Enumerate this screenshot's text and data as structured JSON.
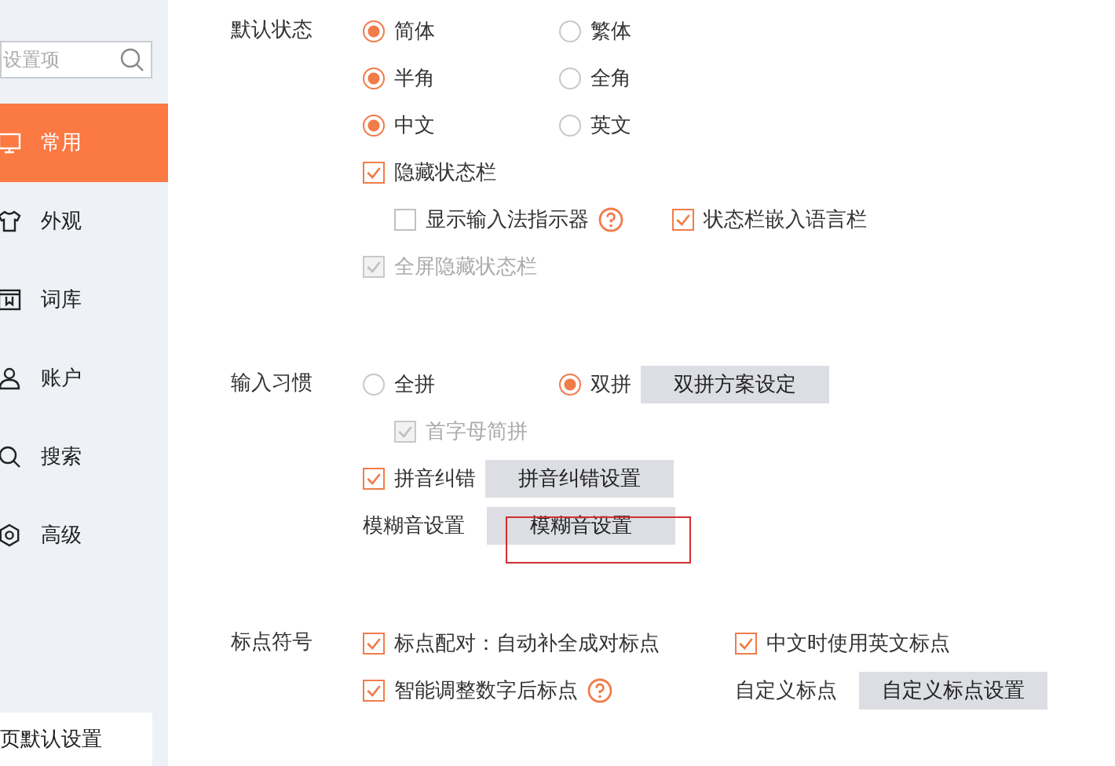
{
  "sidebar": {
    "search": {
      "placeholder": "设置项"
    },
    "items": [
      {
        "label": "常用",
        "selected": true
      },
      {
        "label": "外观",
        "selected": false
      },
      {
        "label": "词库",
        "selected": false
      },
      {
        "label": "账户",
        "selected": false
      },
      {
        "label": "搜索",
        "selected": false
      },
      {
        "label": "高级",
        "selected": false
      }
    ],
    "reset_button": "页默认设置"
  },
  "sections": [
    {
      "label": "默认状态",
      "rows": [
        {
          "cells": [
            [
              {
                "kind": "radio",
                "label": "简体",
                "selected": true
              }
            ],
            [
              {
                "kind": "radio",
                "label": "繁体",
                "selected": false
              }
            ]
          ]
        },
        {
          "cells": [
            [
              {
                "kind": "radio",
                "label": "半角",
                "selected": true
              }
            ],
            [
              {
                "kind": "radio",
                "label": "全角",
                "selected": false
              }
            ]
          ]
        },
        {
          "cells": [
            [
              {
                "kind": "radio",
                "label": "中文",
                "selected": true
              }
            ],
            [
              {
                "kind": "radio",
                "label": "英文",
                "selected": false
              }
            ]
          ]
        },
        {
          "cells": [
            [
              {
                "kind": "checkbox",
                "label": "隐藏状态栏",
                "checked": true,
                "disabled": false
              }
            ]
          ],
          "children": [
            {
              "cells": [
                [
                  {
                    "kind": "checkbox",
                    "label": "显示输入法指示器",
                    "checked": false,
                    "disabled": false
                  },
                  {
                    "kind": "help"
                  }
                ],
                [
                  {
                    "kind": "checkbox",
                    "label": "状态栏嵌入语言栏",
                    "checked": true,
                    "disabled": false
                  }
                ]
              ]
            }
          ]
        },
        {
          "cells": [
            [
              {
                "kind": "checkbox",
                "label": "全屏隐藏状态栏",
                "checked": true,
                "disabled": true
              }
            ]
          ]
        }
      ]
    },
    {
      "label": "输入习惯",
      "rows": [
        {
          "cells": [
            [
              {
                "kind": "radio",
                "label": "全拼",
                "selected": false
              }
            ],
            [
              {
                "kind": "radio",
                "label": "双拼",
                "selected": true
              },
              {
                "kind": "button",
                "label": "双拼方案设定"
              }
            ]
          ],
          "children": [
            {
              "cells": [
                [
                  {
                    "kind": "checkbox",
                    "label": "首字母简拼",
                    "checked": true,
                    "disabled": true
                  }
                ]
              ]
            }
          ]
        },
        {
          "cells": [
            [
              {
                "kind": "checkbox",
                "label": "拼音纠错",
                "checked": true,
                "disabled": false
              },
              {
                "kind": "button",
                "label": "拼音纠错设置"
              }
            ]
          ]
        },
        {
          "cells": [
            [
              {
                "kind": "text",
                "label": "模糊音设置"
              },
              {
                "kind": "button",
                "label": "模糊音设置",
                "highlighted": true
              }
            ]
          ]
        }
      ]
    },
    {
      "label": "标点符号",
      "rows": [
        {
          "cells": [
            [
              {
                "kind": "checkbox",
                "label": "标点配对：自动补全成对标点",
                "checked": true,
                "disabled": false
              }
            ],
            [
              {
                "kind": "checkbox",
                "label": "中文时使用英文标点",
                "checked": true,
                "disabled": false
              }
            ]
          ]
        },
        {
          "cells": [
            [
              {
                "kind": "checkbox",
                "label": "智能调整数字后标点",
                "checked": true,
                "disabled": false
              },
              {
                "kind": "help"
              }
            ],
            [
              {
                "kind": "text",
                "label": "自定义标点"
              },
              {
                "kind": "button",
                "label": "自定义标点设置"
              }
            ]
          ]
        }
      ]
    }
  ]
}
